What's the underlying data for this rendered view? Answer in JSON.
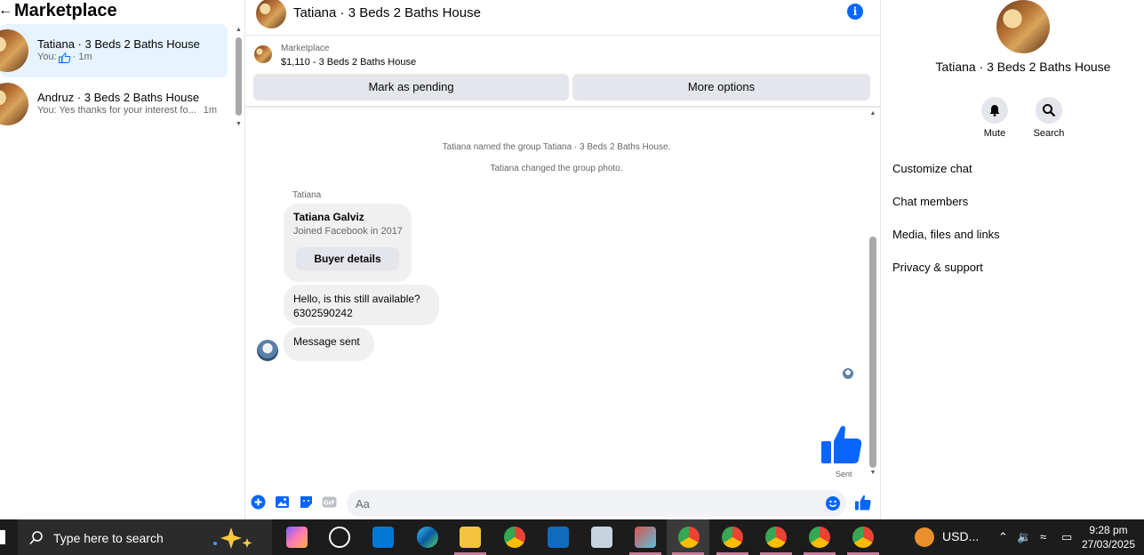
{
  "left_pane": {
    "title": "Marketplace",
    "conversations": [
      {
        "name": "Tatiana · 3 Beds 2 Baths House",
        "preview_prefix": "You:",
        "preview_suffix": "· 1m"
      },
      {
        "name": "Andruz · 3 Beds 2 Baths House",
        "preview": "You: Yes thanks for your interest fo...",
        "time": "1m"
      }
    ]
  },
  "chat": {
    "title": "Tatiana · 3 Beds 2 Baths House",
    "listing": {
      "source": "Marketplace",
      "detail": "$1,110 - 3 Beds 2 Baths House",
      "pending_button": "Mark as pending",
      "more_button": "More options"
    },
    "system_messages": [
      "Tatiana named the group Tatiana · 3 Beds 2 Baths House.",
      "Tatiana changed the group photo."
    ],
    "sender_label": "Tatiana",
    "profile_card": {
      "name": "Tatiana Galviz",
      "subtitle": "Joined Facebook in 2017",
      "button": "Buyer details"
    },
    "messages": [
      {
        "line1": "Hello, is this still available?",
        "line2": "6302590242"
      },
      {
        "text": "Message sent"
      }
    ],
    "sent_label": "Sent",
    "composer_placeholder": "Aa"
  },
  "right_pane": {
    "title": "Tatiana · 3 Beds 2 Baths House",
    "mute_label": "Mute",
    "search_label": "Search",
    "rows": [
      "Customize chat",
      "Chat members",
      "Media, files and links",
      "Privacy & support"
    ]
  },
  "taskbar": {
    "search_placeholder": "Type here to search",
    "tray_text": "USD...",
    "time": "9:28 pm",
    "date": "27/03/2025"
  },
  "colors": {
    "accent": "#0866ff",
    "active_conversation": "#e7f3ff",
    "taskbar": "#1c1c1c"
  }
}
